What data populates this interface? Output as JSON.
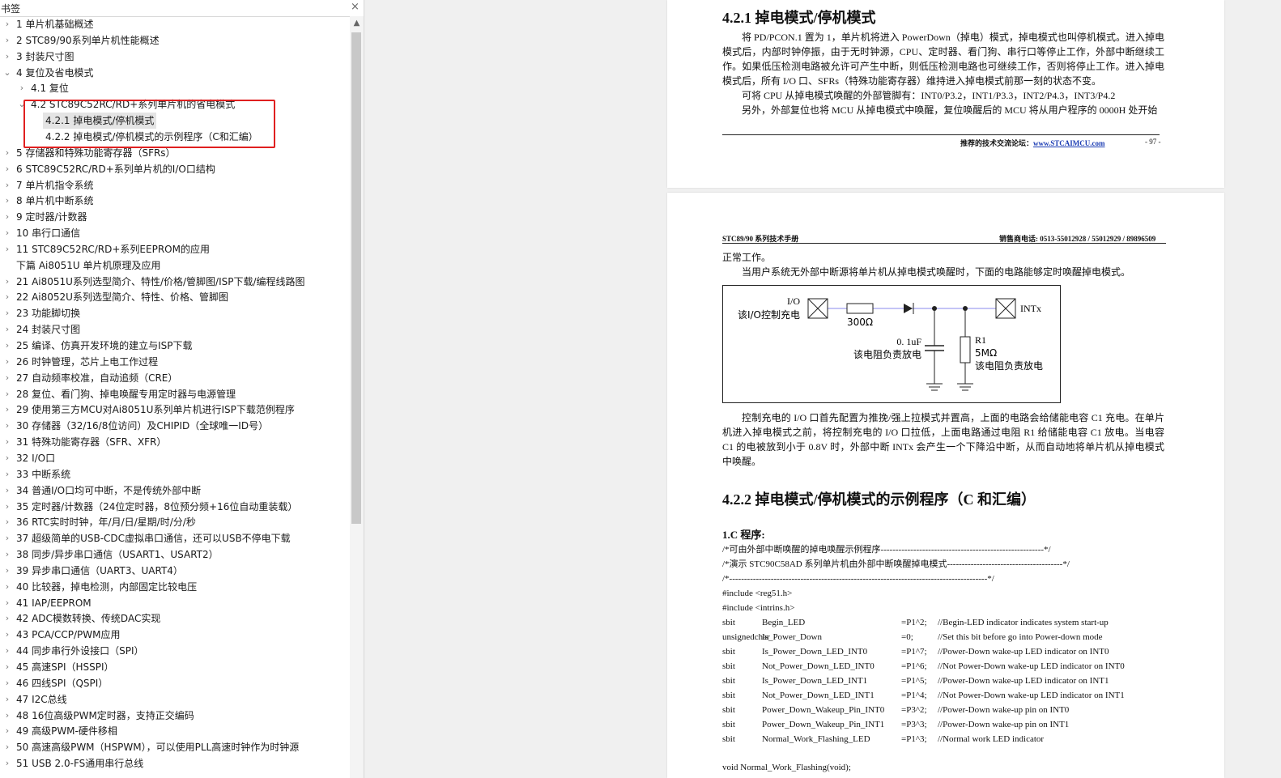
{
  "panel": {
    "title": "书签",
    "close_glyph": "×",
    "scroll_up_glyph": "▲",
    "items": [
      {
        "level": 0,
        "expand": "collapsed",
        "label": "1 单片机基础概述"
      },
      {
        "level": 0,
        "expand": "collapsed",
        "label": "2 STC89/90系列单片机性能概述"
      },
      {
        "level": 0,
        "expand": "collapsed",
        "label": "3 封装尺寸图"
      },
      {
        "level": 0,
        "expand": "expanded",
        "label": "4 复位及省电模式"
      },
      {
        "level": 1,
        "expand": "collapsed",
        "label": "4.1 复位"
      },
      {
        "level": 1,
        "expand": "expanded",
        "label": "4.2 STC89C52RC/RD+系列单片机的省电模式"
      },
      {
        "level": 2,
        "expand": "none",
        "label": "4.2.1 掉电模式/停机模式",
        "selected": true
      },
      {
        "level": 2,
        "expand": "none",
        "label": "4.2.2 掉电模式/停机模式的示例程序（C和汇编）"
      },
      {
        "level": 0,
        "expand": "collapsed",
        "label": "5 存储器和特殊功能寄存器（SFRs）"
      },
      {
        "level": 0,
        "expand": "collapsed",
        "label": "6 STC89C52RC/RD+系列单片机的I/O口结构"
      },
      {
        "level": 0,
        "expand": "collapsed",
        "label": "7 单片机指令系统"
      },
      {
        "level": 0,
        "expand": "collapsed",
        "label": "8 单片机中断系统"
      },
      {
        "level": 0,
        "expand": "collapsed",
        "label": "9 定时器/计数器"
      },
      {
        "level": 0,
        "expand": "collapsed",
        "label": "10 串行口通信"
      },
      {
        "level": 0,
        "expand": "collapsed",
        "label": "11 STC89C52RC/RD+系列EEPROM的应用"
      },
      {
        "level": 0,
        "expand": "none",
        "label": "下篇 Ai8051U 单片机原理及应用"
      },
      {
        "level": 0,
        "expand": "collapsed",
        "label": "21 Ai8051U系列选型简介、特性/价格/管脚图/ISP下载/编程线路图"
      },
      {
        "level": 0,
        "expand": "collapsed",
        "label": "22 Ai8052U系列选型简介、特性、价格、管脚图"
      },
      {
        "level": 0,
        "expand": "collapsed",
        "label": "23 功能脚切换"
      },
      {
        "level": 0,
        "expand": "collapsed",
        "label": "24 封装尺寸图"
      },
      {
        "level": 0,
        "expand": "collapsed",
        "label": "25 编译、仿真开发环境的建立与ISP下载"
      },
      {
        "level": 0,
        "expand": "collapsed",
        "label": "26 时钟管理，芯片上电工作过程"
      },
      {
        "level": 0,
        "expand": "collapsed",
        "label": "27 自动频率校准，自动追频（CRE）"
      },
      {
        "level": 0,
        "expand": "collapsed",
        "label": "28 复位、看门狗、掉电唤醒专用定时器与电源管理"
      },
      {
        "level": 0,
        "expand": "collapsed",
        "label": "29 使用第三方MCU对Ai8051U系列单片机进行ISP下载范例程序"
      },
      {
        "level": 0,
        "expand": "collapsed",
        "label": "30 存储器（32/16/8位访问）及CHIPID（全球唯一ID号）"
      },
      {
        "level": 0,
        "expand": "collapsed",
        "label": "31 特殊功能寄存器（SFR、XFR）"
      },
      {
        "level": 0,
        "expand": "collapsed",
        "label": "32 I/O口"
      },
      {
        "level": 0,
        "expand": "collapsed",
        "label": "33 中断系统"
      },
      {
        "level": 0,
        "expand": "collapsed",
        "label": "34 普通I/O口均可中断，不是传统外部中断"
      },
      {
        "level": 0,
        "expand": "collapsed",
        "label": "35 定时器/计数器（24位定时器，8位预分频+16位自动重装载）"
      },
      {
        "level": 0,
        "expand": "collapsed",
        "label": "36 RTC实时时钟，年/月/日/星期/时/分/秒"
      },
      {
        "level": 0,
        "expand": "collapsed",
        "label": "37 超级简单的USB-CDC虚拟串口通信，还可以USB不停电下载"
      },
      {
        "level": 0,
        "expand": "collapsed",
        "label": "38 同步/异步串口通信（USART1、USART2）"
      },
      {
        "level": 0,
        "expand": "collapsed",
        "label": "39 异步串口通信（UART3、UART4）"
      },
      {
        "level": 0,
        "expand": "collapsed",
        "label": "40 比较器，掉电检测，内部固定比较电压"
      },
      {
        "level": 0,
        "expand": "collapsed",
        "label": "41 IAP/EEPROM"
      },
      {
        "level": 0,
        "expand": "collapsed",
        "label": "42 ADC模数转换、传统DAC实现"
      },
      {
        "level": 0,
        "expand": "collapsed",
        "label": "43 PCA/CCP/PWM应用"
      },
      {
        "level": 0,
        "expand": "collapsed",
        "label": "44 同步串行外设接口（SPI）"
      },
      {
        "level": 0,
        "expand": "collapsed",
        "label": "45 高速SPI（HSSPI）"
      },
      {
        "level": 0,
        "expand": "collapsed",
        "label": "46 四线SPI（QSPI）"
      },
      {
        "level": 0,
        "expand": "collapsed",
        "label": "47 I2C总线"
      },
      {
        "level": 0,
        "expand": "collapsed",
        "label": "48 16位高级PWM定时器，支持正交编码"
      },
      {
        "level": 0,
        "expand": "collapsed",
        "label": "49 高级PWM-硬件移相"
      },
      {
        "level": 0,
        "expand": "collapsed",
        "label": "50 高速高级PWM（HSPWM），可以使用PLL高速时钟作为时钟源"
      },
      {
        "level": 0,
        "expand": "collapsed",
        "label": "51 USB 2.0-FS通用串行总线"
      }
    ]
  },
  "page1": {
    "heading": "4.2.1    掉电模式/停机模式",
    "paragraphs": [
      "将 PD/PCON.1 置为 1，单片机将进入 PowerDown（掉电）模式，掉电模式也叫停机模式。进入掉电模式后，内部时钟停振，由于无时钟源，CPU、定时器、看门狗、串行口等停止工作，外部中断继续工作。如果低压检测电路被允许可产生中断，则低压检测电路也可继续工作，否则将停止工作。进入掉电模式后，所有 I/O 口、SFRs（特殊功能寄存器）维持进入掉电模式前那一刻的状态不变。",
      "可将 CPU 从掉电模式唤醒的外部管脚有：INT0/P3.2，INT1/P3.3，INT2/P4.3，INT3/P4.2",
      "另外，外部复位也将 MCU 从掉电模式中唤醒，复位唤醒后的 MCU 将从用户程序的 0000H 处开始"
    ],
    "footer_label": "推荐的技术交流论坛：",
    "footer_link": "www.STCAIMCU.com",
    "page_number": "- 97 -"
  },
  "page2": {
    "header_left": "STC89/90 系列技术手册",
    "header_right": "销售商电话: 0513-55012928 / 55012929 / 89896509",
    "intro_lines": [
      "正常工作。",
      "当用户系统无外部中断源将单片机从掉电模式唤醒时，下面的电路能够定时唤醒掉电模式。"
    ],
    "circuit": {
      "io_label": "I/O",
      "io_desc": "该I/O控制充电",
      "resistor_label": "300Ω",
      "int_label": "INTx",
      "cap_value": "0. 1uF",
      "cap_desc": "该电阻负责放电",
      "r1_name": "R1",
      "r1_value": "5MΩ",
      "r1_desc": "该电阻负责放电",
      "wire_color": "#8888ee"
    },
    "body_paragraph": "控制充电的 I/O 口首先配置为推挽/强上拉模式并置高，上面的电路会给储能电容 C1 充电。在单片机进入掉电模式之前，将控制充电的 I/O 口拉低，上面电路通过电阻 R1 给储能电容 C1 放电。当电容 C1 的电被放到小于 0.8V 时，外部中断 INTx 会产生一个下降沿中断，从而自动地将单片机从掉电模式中唤醒。",
    "heading": "4.2.2    掉电模式/停机模式的示例程序（C 和汇编）",
    "sub_heading": "1.C 程序:",
    "comment_lines": [
      "/*可由外部中断唤醒的掉电唤醒示例程序-------------------------------------------------------*/",
      "/*演示 STC90C58AD 系列单片机由外部中断唤醒掉电模式---------------------------------------*/",
      "/*---------------------------------------------------------------------------------------*/",
      "#include <reg51.h>",
      "#include <intrins.h>"
    ],
    "code_rows": [
      {
        "type": "sbit",
        "name": "Begin_LED",
        "assign": "=P1^2;",
        "comment": "//Begin-LED indicator indicates system start-up"
      },
      {
        "type": "unsignedchar",
        "name": "Is_Power_Down",
        "assign": "=0;",
        "comment": "//Set this bit before go into Power-down mode"
      },
      {
        "type": "sbit",
        "name": "Is_Power_Down_LED_INT0",
        "assign": "=P1^7;",
        "comment": "//Power-Down wake-up LED indicator on INT0"
      },
      {
        "type": "sbit",
        "name": "Not_Power_Down_LED_INT0",
        "assign": "=P1^6;",
        "comment": "//Not Power-Down wake-up LED indicator on INT0"
      },
      {
        "type": "sbit",
        "name": "Is_Power_Down_LED_INT1",
        "assign": "=P1^5;",
        "comment": "//Power-Down wake-up LED indicator on INT1"
      },
      {
        "type": "sbit",
        "name": "Not_Power_Down_LED_INT1",
        "assign": "=P1^4;",
        "comment": "//Not Power-Down wake-up LED indicator on INT1"
      },
      {
        "type": "sbit",
        "name": "Power_Down_Wakeup_Pin_INT0",
        "assign": "=P3^2;",
        "comment": "//Power-Down wake-up pin on INT0"
      },
      {
        "type": "sbit",
        "name": "Power_Down_Wakeup_Pin_INT1",
        "assign": "=P3^3;",
        "comment": "//Power-Down wake-up pin on INT1"
      },
      {
        "type": "sbit",
        "name": "Normal_Work_Flashing_LED",
        "assign": "=P1^3;",
        "comment": "//Normal work LED indicator"
      }
    ],
    "last_line": "void Normal_Work_Flashing(void);"
  }
}
